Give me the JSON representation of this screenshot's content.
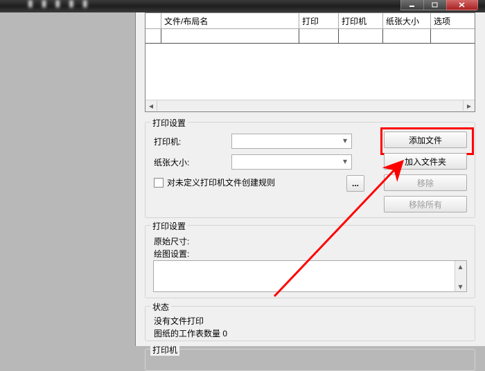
{
  "table": {
    "headers": [
      "",
      "文件/布局名",
      "打印",
      "打印机",
      "纸张大小",
      "选项"
    ]
  },
  "groups": {
    "print": {
      "title": "打印设置",
      "printer": "打印机:",
      "paper": "纸张大小:",
      "rules_chk": "对未定义打印机文件创建规则"
    },
    "print2": {
      "title": "打印设置",
      "orig": "原始尺寸:",
      "plot": "绘图设置:"
    },
    "status": {
      "title": "状态",
      "line1": "没有文件打印",
      "line2_prefix": "图纸的工作表数量 ",
      "count": "0"
    },
    "printer": {
      "title": "打印机"
    }
  },
  "buttons": {
    "add_file": "添加文件",
    "add_folder": "加入文件夹",
    "remove": "移除",
    "remove_all": "移除所有",
    "more": "..."
  }
}
